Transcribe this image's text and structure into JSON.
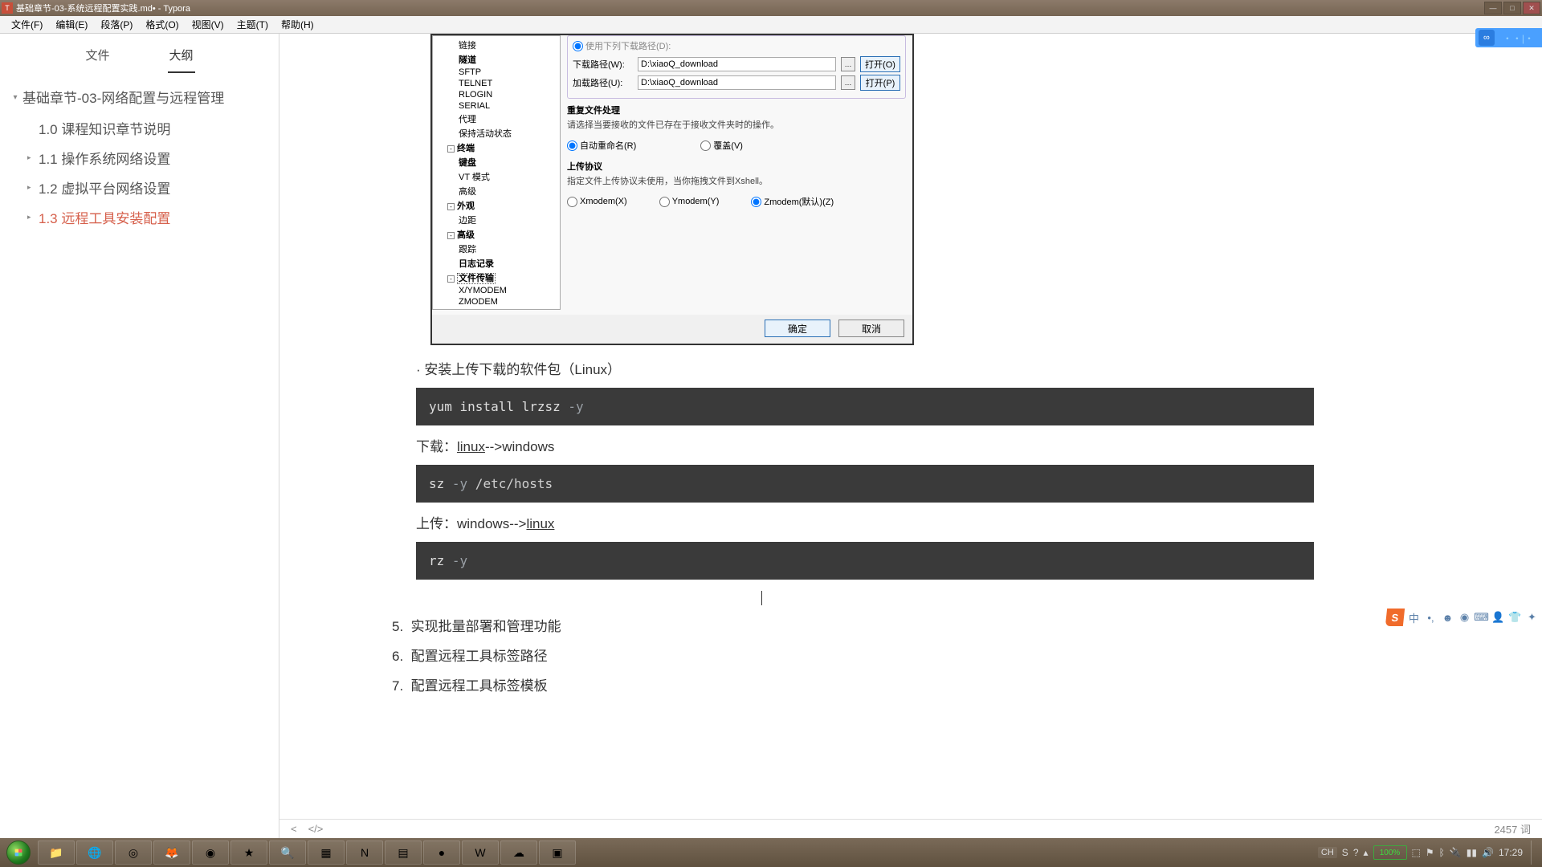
{
  "window": {
    "title": "基础章节-03-系统远程配置实践.md• - Typora"
  },
  "menubar": [
    "文件(F)",
    "编辑(E)",
    "段落(P)",
    "格式(O)",
    "视图(V)",
    "主题(T)",
    "帮助(H)"
  ],
  "sidebar": {
    "tabs": {
      "file": "文件",
      "outline": "大纲"
    },
    "root": "基础章节-03-网络配置与远程管理",
    "items": [
      {
        "label": "1.0 课程知识章节说明",
        "hasChildren": false
      },
      {
        "label": "1.1 操作系统网络设置",
        "hasChildren": true
      },
      {
        "label": "1.2 虚拟平台网络设置",
        "hasChildren": true
      },
      {
        "label": "1.3 远程工具安装配置",
        "hasChildren": true,
        "active": true
      }
    ]
  },
  "dialog": {
    "tree_top": [
      "链接",
      "隧道",
      "SFTP",
      "TELNET",
      "RLOGIN",
      "SERIAL",
      "代理",
      "保持活动状态"
    ],
    "tree_groups": [
      {
        "label": "终端",
        "children": [
          "键盘",
          "VT 模式",
          "高级"
        ]
      },
      {
        "label": "外观",
        "children": [
          "边距"
        ]
      },
      {
        "label": "高级",
        "children": [
          "跟踪",
          "日志记录",
          "文件传输",
          "X/YMODEM",
          "ZMODEM"
        ]
      }
    ],
    "selected": "文件传输",
    "path_cut": "使用下列下载路径(D):",
    "download_label": "下载路径(W):",
    "upload_label": "加载路径(U):",
    "path_value": "D:\\xiaoQ_download",
    "open_o": "打开(O)",
    "open_p": "打开(P)",
    "dup_title": "重复文件处理",
    "dup_desc": "请选择当要接收的文件已存在于接收文件夹时的操作。",
    "dup_auto": "自动重命名(R)",
    "dup_over": "覆盖(V)",
    "up_title": "上传协议",
    "up_desc": "指定文件上传协议未使用，当你拖拽文件到Xshell。",
    "proto_x": "Xmodem(X)",
    "proto_y": "Ymodem(Y)",
    "proto_z": "Zmodem(默认)(Z)",
    "ok": "确定",
    "cancel": "取消"
  },
  "content": {
    "bullet1": "安装上传下载的软件包（Linux）",
    "code1": {
      "cmd": "yum install lrzsz ",
      "flag": "-y"
    },
    "p_download_pre": "下载：",
    "p_download_link": "linux",
    "p_download_post": "-->windows",
    "code2": {
      "cmd": "sz ",
      "flag": "-y",
      "path": " /etc/hosts"
    },
    "p_upload_pre": "上传：windows-->",
    "p_upload_link": "linux",
    "code3": {
      "cmd": "rz ",
      "flag": "-y"
    },
    "list": [
      {
        "num": "5.",
        "text": "实现批量部署和管理功能"
      },
      {
        "num": "6.",
        "text": "配置远程工具标签路径"
      },
      {
        "num": "7.",
        "text": "配置远程工具标签模板"
      }
    ]
  },
  "statusbar": {
    "back": "<",
    "code": "</>",
    "wordcount": "2457 词"
  },
  "quickfloat": {
    "text": "・・|・"
  },
  "ime": {
    "logo": "S"
  },
  "taskbar": {
    "tray_lang": "CH",
    "battery": "100%",
    "time": "17:29"
  }
}
